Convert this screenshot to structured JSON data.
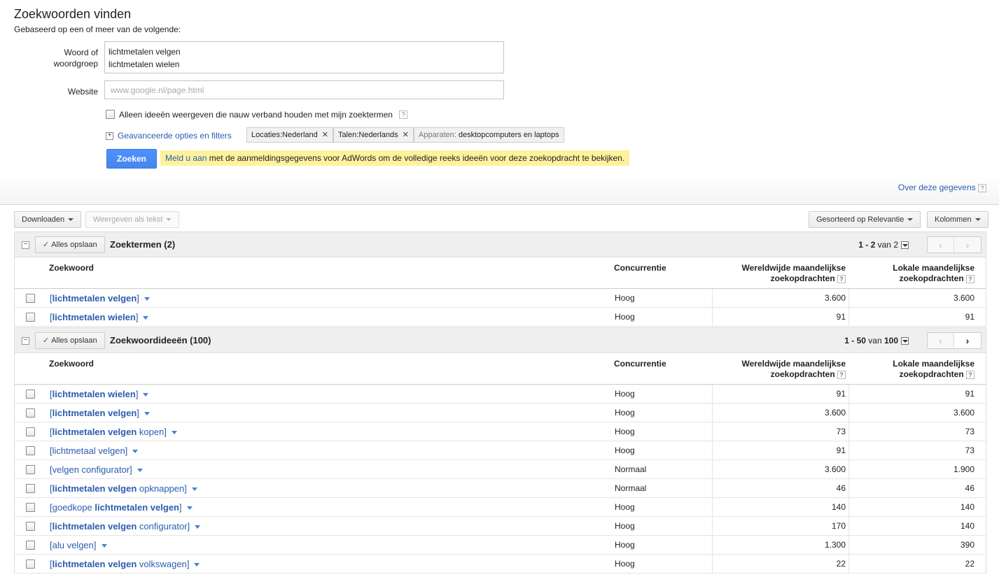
{
  "header": {
    "title": "Zoekwoorden vinden",
    "subtitle": "Gebaseerd op een of meer van de volgende:"
  },
  "form": {
    "keyword_label_1": "Woord of",
    "keyword_label_2": "woordgroep",
    "keyword_value": "lichtmetalen velgen\nlichtmetalen wielen",
    "website_label": "Website",
    "website_placeholder": "www.google.nl/page.html",
    "only_related_label": "Alleen ideeën weergeven die nauw verband houden met mijn zoektermen",
    "advanced_label": "Geavanceerde opties en filters",
    "chips": {
      "locations": "Locaties:Nederland",
      "languages": "Talen:Nederlands",
      "devices_prefix": "Apparaten:",
      "devices_value": "desktopcomputers en laptops"
    },
    "search_button": "Zoeken",
    "notice_link": "Meld u aan",
    "notice_text": " met de aanmeldingsgegevens voor AdWords om de volledige reeks ideeën voor deze zoekopdracht te bekijken.",
    "about_data": "Over deze gegevens"
  },
  "toolbar": {
    "download": "Downloaden",
    "show_as_text": "Weergeven als tekst",
    "sorted": "Gesorteerd op Relevantie",
    "columns": "Kolommen"
  },
  "columns": {
    "keyword": "Zoekwoord",
    "competition": "Concurrentie",
    "global_1": "Wereldwijde maandelijkse",
    "global_2": "zoekopdrachten",
    "local_1": "Lokale maandelijkse",
    "local_2": "zoekopdrachten"
  },
  "search_terms": {
    "save_all": "Alles opslaan",
    "title": "Zoektermen (2)",
    "pager_range": "1 - 2",
    "pager_of": "van",
    "pager_total": "2",
    "rows": [
      {
        "pre": "[",
        "bold": "lichtmetalen velgen",
        "post": "]",
        "competition": "Hoog",
        "global": "3.600",
        "local": "3.600"
      },
      {
        "pre": "[",
        "bold": "lichtmetalen wielen",
        "post": "]",
        "competition": "Hoog",
        "global": "91",
        "local": "91"
      }
    ]
  },
  "ideas": {
    "save_all": "Alles opslaan",
    "title": "Zoekwoordideeën (100)",
    "pager_range": "1 - 50",
    "pager_of": "van",
    "pager_total": "100",
    "rows": [
      {
        "pre": "[",
        "bold": "lichtmetalen wielen",
        "post": "]",
        "competition": "Hoog",
        "global": "91",
        "local": "91"
      },
      {
        "pre": "[",
        "bold": "lichtmetalen velgen",
        "post": "]",
        "competition": "Hoog",
        "global": "3.600",
        "local": "3.600"
      },
      {
        "pre": "[",
        "bold": "lichtmetalen velgen",
        "post": " kopen]",
        "competition": "Hoog",
        "global": "73",
        "local": "73"
      },
      {
        "pre": "[lichtmetaal velgen]",
        "bold": "",
        "post": "",
        "competition": "Hoog",
        "global": "91",
        "local": "73"
      },
      {
        "pre": "[velgen configurator]",
        "bold": "",
        "post": "",
        "competition": "Normaal",
        "global": "3.600",
        "local": "1.900"
      },
      {
        "pre": "[",
        "bold": "lichtmetalen velgen",
        "post": " opknappen]",
        "competition": "Normaal",
        "global": "46",
        "local": "46"
      },
      {
        "pre": "[goedkope ",
        "bold": "lichtmetalen velgen",
        "post": "]",
        "competition": "Hoog",
        "global": "140",
        "local": "140"
      },
      {
        "pre": "[",
        "bold": "lichtmetalen velgen",
        "post": " configurator]",
        "competition": "Hoog",
        "global": "170",
        "local": "140"
      },
      {
        "pre": "[alu velgen]",
        "bold": "",
        "post": "",
        "competition": "Hoog",
        "global": "1.300",
        "local": "390"
      },
      {
        "pre": "[",
        "bold": "lichtmetalen velgen",
        "post": " volkswagen]",
        "competition": "Hoog",
        "global": "22",
        "local": "22"
      }
    ]
  },
  "colors": {
    "link": "#2a5db0",
    "primary_button": "#4d90fe",
    "notice_bg": "#fff29e"
  }
}
